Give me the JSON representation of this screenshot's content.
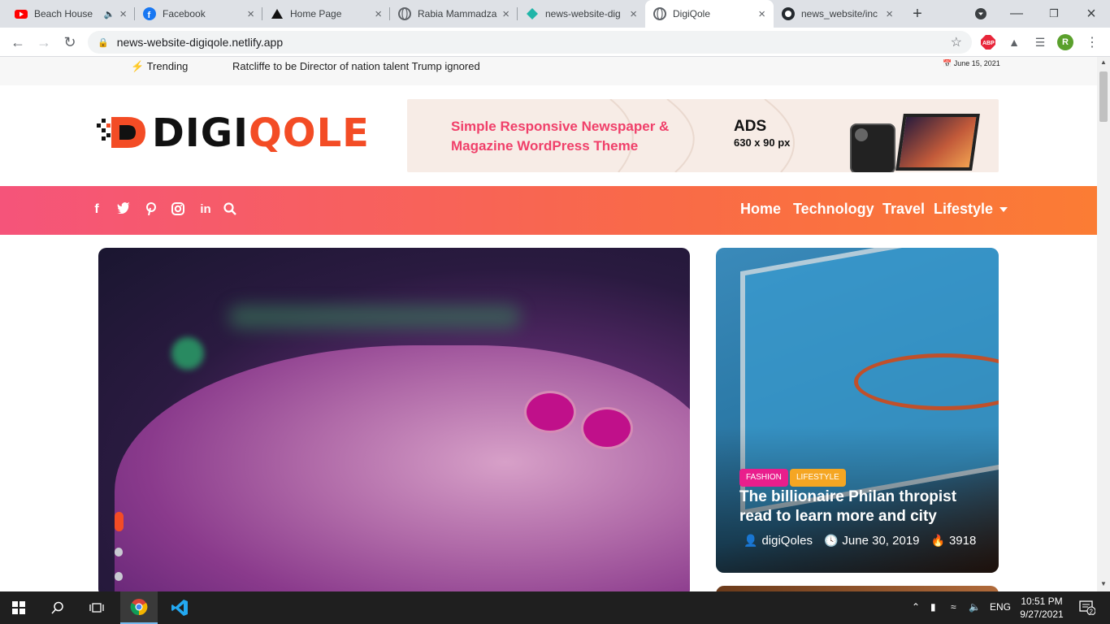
{
  "browser": {
    "tabs": [
      {
        "label": "Beach House",
        "icon": "youtube-icon",
        "audio": true,
        "active": false
      },
      {
        "label": "Facebook",
        "icon": "facebook-icon",
        "audio": false,
        "active": false
      },
      {
        "label": "Home Page",
        "icon": "triangle-icon",
        "audio": false,
        "active": false
      },
      {
        "label": "Rabia Mammadza",
        "icon": "globe-icon",
        "audio": false,
        "active": false
      },
      {
        "label": "news-website-dig",
        "icon": "netlify-icon",
        "audio": false,
        "active": false
      },
      {
        "label": "DigiQole",
        "icon": "globe-icon",
        "audio": false,
        "active": true
      },
      {
        "label": "news_website/inc",
        "icon": "github-icon",
        "audio": false,
        "active": false
      }
    ],
    "url": "news-website-digiqole.netlify.app",
    "extensions": {
      "abp": "ABP",
      "profile": "R"
    }
  },
  "site": {
    "topbar": {
      "trending_label": "Trending",
      "headline": "Ratcliffe to be Director of nation talent Trump ignored",
      "date": "June 15, 2021"
    },
    "logo": {
      "part1": "DIGI",
      "part2": "QOLE"
    },
    "ad": {
      "tagline_line1": "Simple Responsive Newspaper &",
      "tagline_line2": "Magazine WordPress Theme",
      "title": "ADS",
      "size": "630 x 90 px"
    },
    "social": [
      "f",
      "twitter",
      "pinterest",
      "instagram",
      "in",
      "search"
    ],
    "menu": [
      {
        "label": "Home"
      },
      {
        "label": "Technology"
      },
      {
        "label": "Travel"
      },
      {
        "label": "Lifestyle"
      }
    ],
    "hero": {
      "slide_count": 3,
      "active_slide": 1
    },
    "card": {
      "badges": [
        {
          "label": "Fashion",
          "color": "#e91e8c"
        },
        {
          "label": "Lifestyle",
          "color": "#f5a623"
        }
      ],
      "title": "The billionaire Philan thropist read to learn more and city",
      "author": "digiQoles",
      "date": "June 30, 2019",
      "views": "3918"
    }
  },
  "taskbar": {
    "language": "ENG",
    "time": "10:51 PM",
    "date": "9/27/2021",
    "notifications": "2"
  },
  "colors": {
    "accent": "#f34c25",
    "nav_start": "#f5547a",
    "nav_end": "#fb7c34"
  }
}
